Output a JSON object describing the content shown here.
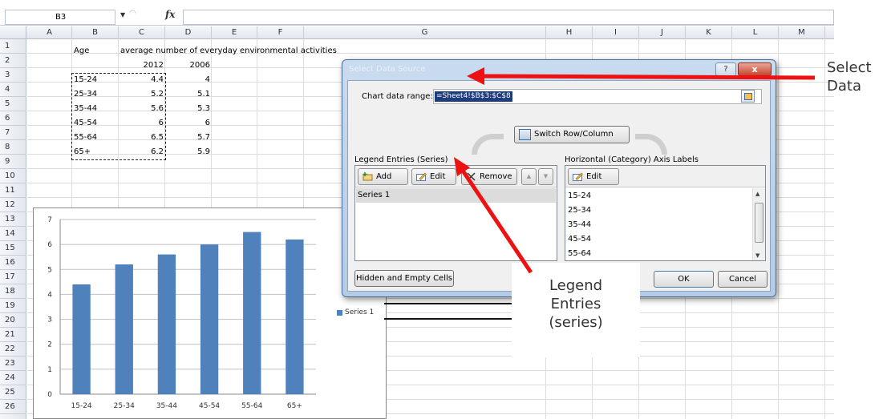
{
  "formula_bar": {
    "name_box": "B3",
    "formula": "",
    "fx_symbol": "fx"
  },
  "columns": [
    "A",
    "B",
    "C",
    "D",
    "E",
    "F",
    "G",
    "H",
    "I",
    "J",
    "K",
    "L",
    "M"
  ],
  "rows": [
    "1",
    "2",
    "3",
    "4",
    "5",
    "6",
    "7",
    "8",
    "9",
    "10",
    "11",
    "12",
    "13",
    "14",
    "15",
    "16",
    "17",
    "18",
    "19",
    "20",
    "21",
    "22",
    "23",
    "24",
    "25",
    "26"
  ],
  "sheet": {
    "b1": "Age",
    "c1": "average number of everyday environmental activities",
    "c2": "2012",
    "d2": "2006",
    "data_rows": [
      {
        "age": "15-24",
        "v2012": "4.4",
        "v2006": "4"
      },
      {
        "age": "25-34",
        "v2012": "5.2",
        "v2006": "5.1"
      },
      {
        "age": "35-44",
        "v2012": "5.6",
        "v2006": "5.3"
      },
      {
        "age": "45-54",
        "v2012": "6",
        "v2006": "6"
      },
      {
        "age": "55-64",
        "v2012": "6.5",
        "v2006": "5.7"
      },
      {
        "age": "65+",
        "v2012": "6.2",
        "v2006": "5.9"
      }
    ]
  },
  "chart_data": {
    "type": "bar",
    "categories": [
      "15-24",
      "25-34",
      "35-44",
      "45-54",
      "55-64",
      "65+"
    ],
    "series": [
      {
        "name": "Series 1",
        "values": [
          4.4,
          5.2,
          5.6,
          6,
          6.5,
          6.2
        ],
        "color": "#4f81bd"
      }
    ],
    "ylim": [
      0,
      7
    ],
    "yticks": [
      "0",
      "1",
      "2",
      "3",
      "4",
      "5",
      "6",
      "7"
    ],
    "grid": true,
    "legend": "right",
    "title": "",
    "xlabel": "",
    "ylabel": ""
  },
  "dialog": {
    "title": "Select Data Source",
    "help_label": "?",
    "close_label": "x",
    "range_label": "Chart data range:",
    "range_value": "=Sheet4!$B$3:$C$8",
    "switch_label": "Switch Row/Column",
    "legend_title": "Legend Entries (Series)",
    "axis_title": "Horizontal (Category) Axis Labels",
    "add_label": "Add",
    "edit_label": "Edit",
    "remove_label": "Remove",
    "move_up_label": "▲",
    "move_down_label": "▼",
    "axis_edit_label": "Edit",
    "series": [
      "Series 1"
    ],
    "axis_labels": [
      "15-24",
      "25-34",
      "35-44",
      "45-54",
      "55-64"
    ],
    "hidden_cells_label": "Hidden and Empty Cells",
    "ok_label": "OK",
    "cancel_label": "Cancel"
  },
  "annotations": {
    "select_data_line1": "Select",
    "select_data_line2": "Data",
    "legend_line1": "Legend",
    "legend_line2": "Entries",
    "legend_line3": "(series)"
  },
  "colors": {
    "accent": "#4f81bd",
    "annotation_arrow": "#ee1111",
    "dialog_title_bar": "#b3cbe6",
    "close_button": "#c7452f"
  }
}
